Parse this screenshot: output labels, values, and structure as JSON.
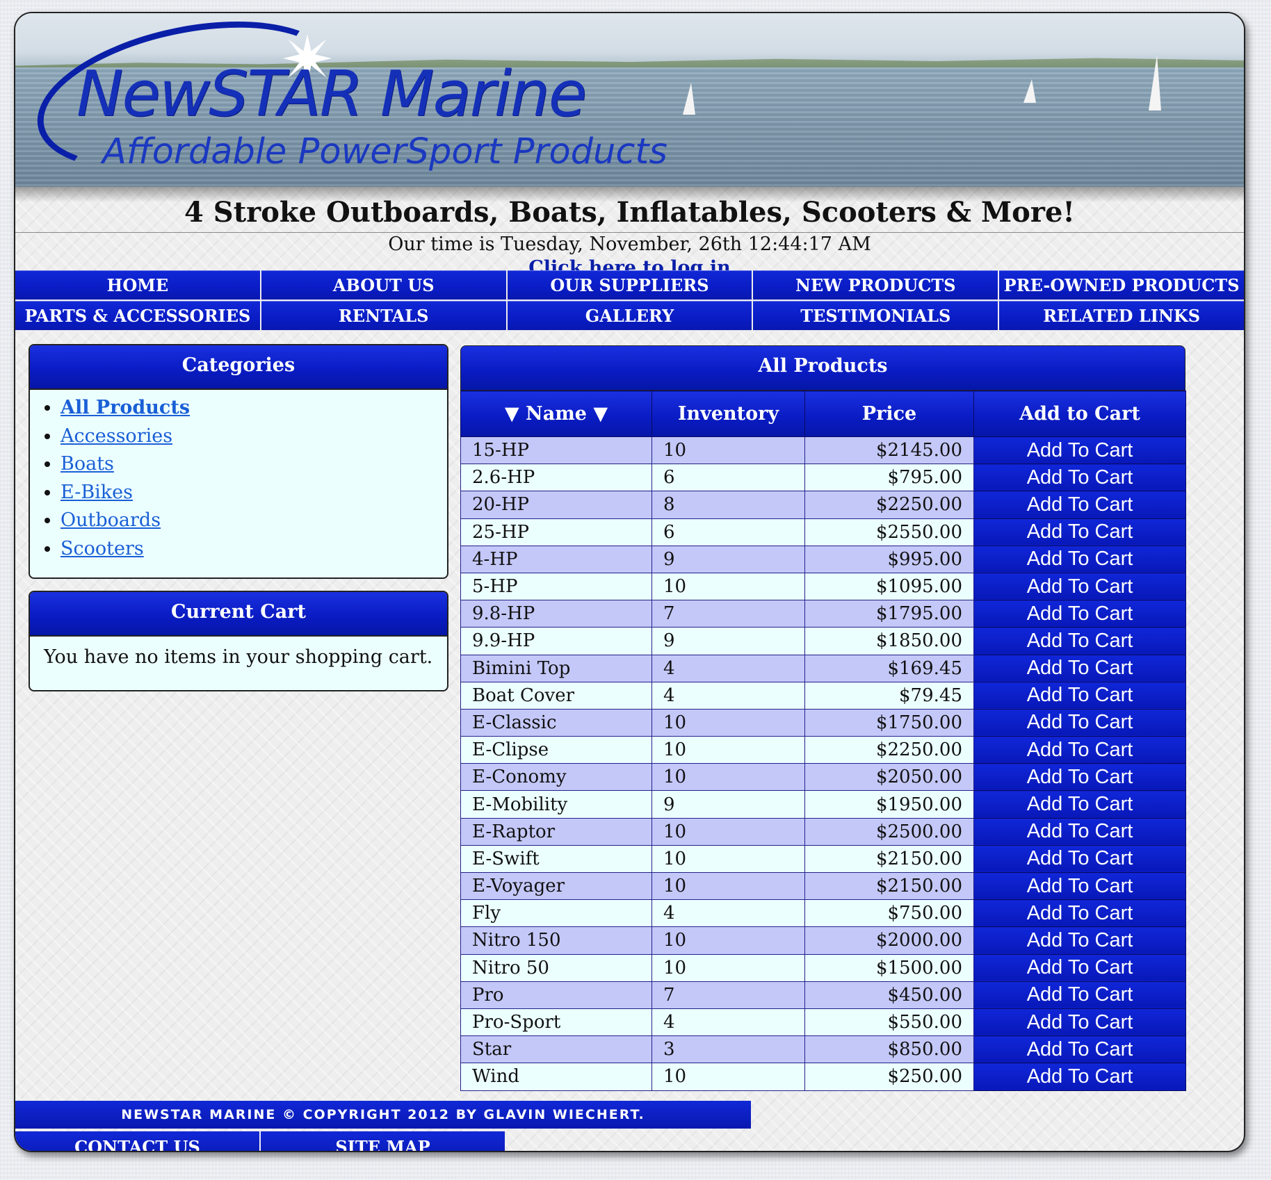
{
  "banner": {
    "logo_title": "NewSTAR Marine",
    "logo_subtitle": "Affordable PowerSport Products"
  },
  "tagline": "4 Stroke Outboards, Boats, Inflatables, Scooters & More!",
  "time_text": "Our time is Tuesday, November, 26th 12:44:17 AM",
  "login_link": "Click here to log in",
  "nav": [
    "HOME",
    "ABOUT US",
    "OUR SUPPLIERS",
    "NEW PRODUCTS",
    "PRE-OWNED PRODUCTS",
    "PARTS & ACCESSORIES",
    "RENTALS",
    "GALLERY",
    "TESTIMONIALS",
    "RELATED LINKS"
  ],
  "categories": {
    "title": "Categories",
    "items": [
      "All Products",
      "Accessories",
      "Boats",
      "E-Bikes",
      "Outboards",
      "Scooters"
    ],
    "active_index": 0
  },
  "cart": {
    "title": "Current Cart",
    "message": "You have no items in your shopping cart."
  },
  "products": {
    "title": "All Products",
    "columns": [
      "▼ Name ▼",
      "Inventory",
      "Price",
      "Add to Cart"
    ],
    "button_label": "Add To Cart",
    "rows": [
      {
        "name": "15-HP",
        "inventory": "10",
        "price": "$2145.00"
      },
      {
        "name": "2.6-HP",
        "inventory": "6",
        "price": "$795.00"
      },
      {
        "name": "20-HP",
        "inventory": "8",
        "price": "$2250.00"
      },
      {
        "name": "25-HP",
        "inventory": "6",
        "price": "$2550.00"
      },
      {
        "name": "4-HP",
        "inventory": "9",
        "price": "$995.00"
      },
      {
        "name": "5-HP",
        "inventory": "10",
        "price": "$1095.00"
      },
      {
        "name": "9.8-HP",
        "inventory": "7",
        "price": "$1795.00"
      },
      {
        "name": "9.9-HP",
        "inventory": "9",
        "price": "$1850.00"
      },
      {
        "name": "Bimini Top",
        "inventory": "4",
        "price": "$169.45"
      },
      {
        "name": "Boat Cover",
        "inventory": "4",
        "price": "$79.45"
      },
      {
        "name": "E-Classic",
        "inventory": "10",
        "price": "$1750.00"
      },
      {
        "name": "E-Clipse",
        "inventory": "10",
        "price": "$2250.00"
      },
      {
        "name": "E-Conomy",
        "inventory": "10",
        "price": "$2050.00"
      },
      {
        "name": "E-Mobility",
        "inventory": "9",
        "price": "$1950.00"
      },
      {
        "name": "E-Raptor",
        "inventory": "10",
        "price": "$2500.00"
      },
      {
        "name": "E-Swift",
        "inventory": "10",
        "price": "$2150.00"
      },
      {
        "name": "E-Voyager",
        "inventory": "10",
        "price": "$2150.00"
      },
      {
        "name": "Fly",
        "inventory": "4",
        "price": "$750.00"
      },
      {
        "name": "Nitro 150",
        "inventory": "10",
        "price": "$2000.00"
      },
      {
        "name": "Nitro 50",
        "inventory": "10",
        "price": "$1500.00"
      },
      {
        "name": "Pro",
        "inventory": "7",
        "price": "$450.00"
      },
      {
        "name": "Pro-Sport",
        "inventory": "4",
        "price": "$550.00"
      },
      {
        "name": "Star",
        "inventory": "3",
        "price": "$850.00"
      },
      {
        "name": "Wind",
        "inventory": "10",
        "price": "$250.00"
      }
    ]
  },
  "footer": {
    "copyright": "NEWSTAR MARINE © COPYRIGHT 2012 BY GLAVIN WIECHERT.",
    "links": [
      "CONTACT US",
      "SITE MAP"
    ]
  },
  "colors": {
    "nav_blue": "#0a1cc4",
    "panel_bg": "#ecffff",
    "row_alt": "#c4c8f8",
    "link": "#1a5fd6"
  }
}
